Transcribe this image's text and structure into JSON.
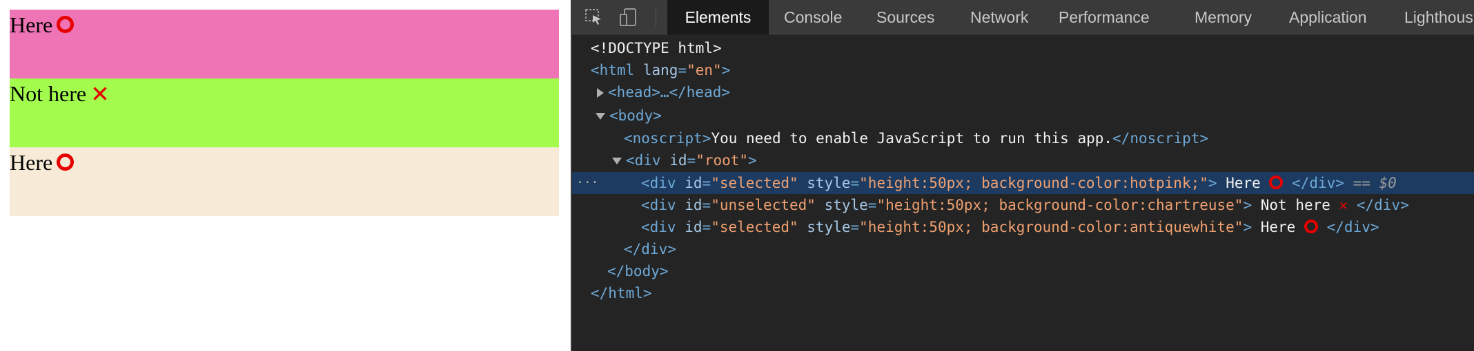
{
  "preview": {
    "blocks": [
      {
        "label": "Here",
        "mark": "red-circle-icon",
        "bg": "#ef74b5"
      },
      {
        "label": "Not here",
        "mark": "red-cross-icon",
        "bg": "#a3fc4d"
      },
      {
        "label": "Here",
        "mark": "red-circle-icon",
        "bg": "#f7ebd8"
      }
    ]
  },
  "devtools": {
    "tabs": [
      "Elements",
      "Console",
      "Sources",
      "Network",
      "Performance",
      "Memory",
      "Application",
      "Lighthous"
    ],
    "active_tab": "Elements",
    "tree": {
      "doctype": "<!DOCTYPE html>",
      "html_open": "<html",
      "html_attr": "lang",
      "html_val": "\"en\"",
      "head": "<head>…</head>",
      "body_open": "<body>",
      "noscript_open": "<noscript>",
      "noscript_text": "You need to enable JavaScript to run this app.",
      "noscript_close": "</noscript>",
      "root_open": "<div",
      "root_attr": "id",
      "root_val": "\"root\"",
      "children": [
        {
          "id": "\"selected\"",
          "style": "\"height:50px; background-color:hotpink;\"",
          "text": " Here ",
          "mark": "o",
          "selected_suffix": "== $0"
        },
        {
          "id": "\"unselected\"",
          "style": "\"height:50px; background-color:chartreuse\"",
          "text": " Not here ",
          "mark": "x",
          "selected_suffix": ""
        },
        {
          "id": "\"selected\"",
          "style": "\"height:50px; background-color:antiquewhite\"",
          "text": " Here ",
          "mark": "o",
          "selected_suffix": ""
        }
      ],
      "div_close": "</div>",
      "body_close": "</body>",
      "html_close": "</html>",
      "ellipsis": "···"
    }
  }
}
